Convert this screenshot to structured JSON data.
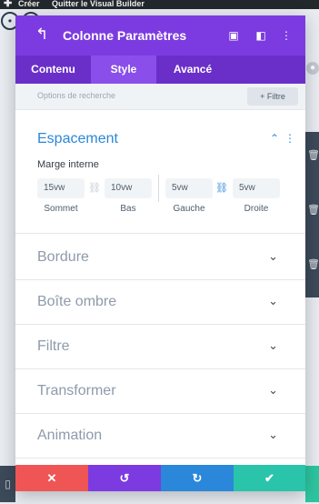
{
  "admin_bar": {
    "create_label": "Créer",
    "quit_label": "Quitter le Visual Builder"
  },
  "modal": {
    "title": "Colonne Paramètres",
    "tabs": [
      {
        "label": "Contenu",
        "active": false
      },
      {
        "label": "Style",
        "active": true
      },
      {
        "label": "Avancé",
        "active": false
      }
    ],
    "search": {
      "placeholder": "Options de recherche",
      "filter_label": "+ Filtre"
    },
    "spacing": {
      "title": "Espacement",
      "padding_label": "Marge interne",
      "fields": [
        {
          "value": "15vw",
          "label": "Sommet"
        },
        {
          "value": "10vw",
          "label": "Bas"
        },
        {
          "value": "5vw",
          "label": "Gauche"
        },
        {
          "value": "5vw",
          "label": "Droite"
        }
      ]
    },
    "sections": [
      "Bordure",
      "Boîte ombre",
      "Filtre",
      "Transformer",
      "Animation"
    ]
  },
  "colors": {
    "header_purple": "#7c3be0",
    "tabs_purple": "#6b2fc9",
    "active_blue": "#2b87da",
    "cancel_red": "#ef5555",
    "undo_purple": "#7c3be0",
    "redo_blue": "#2b87da",
    "save_green": "#29c4a9"
  }
}
